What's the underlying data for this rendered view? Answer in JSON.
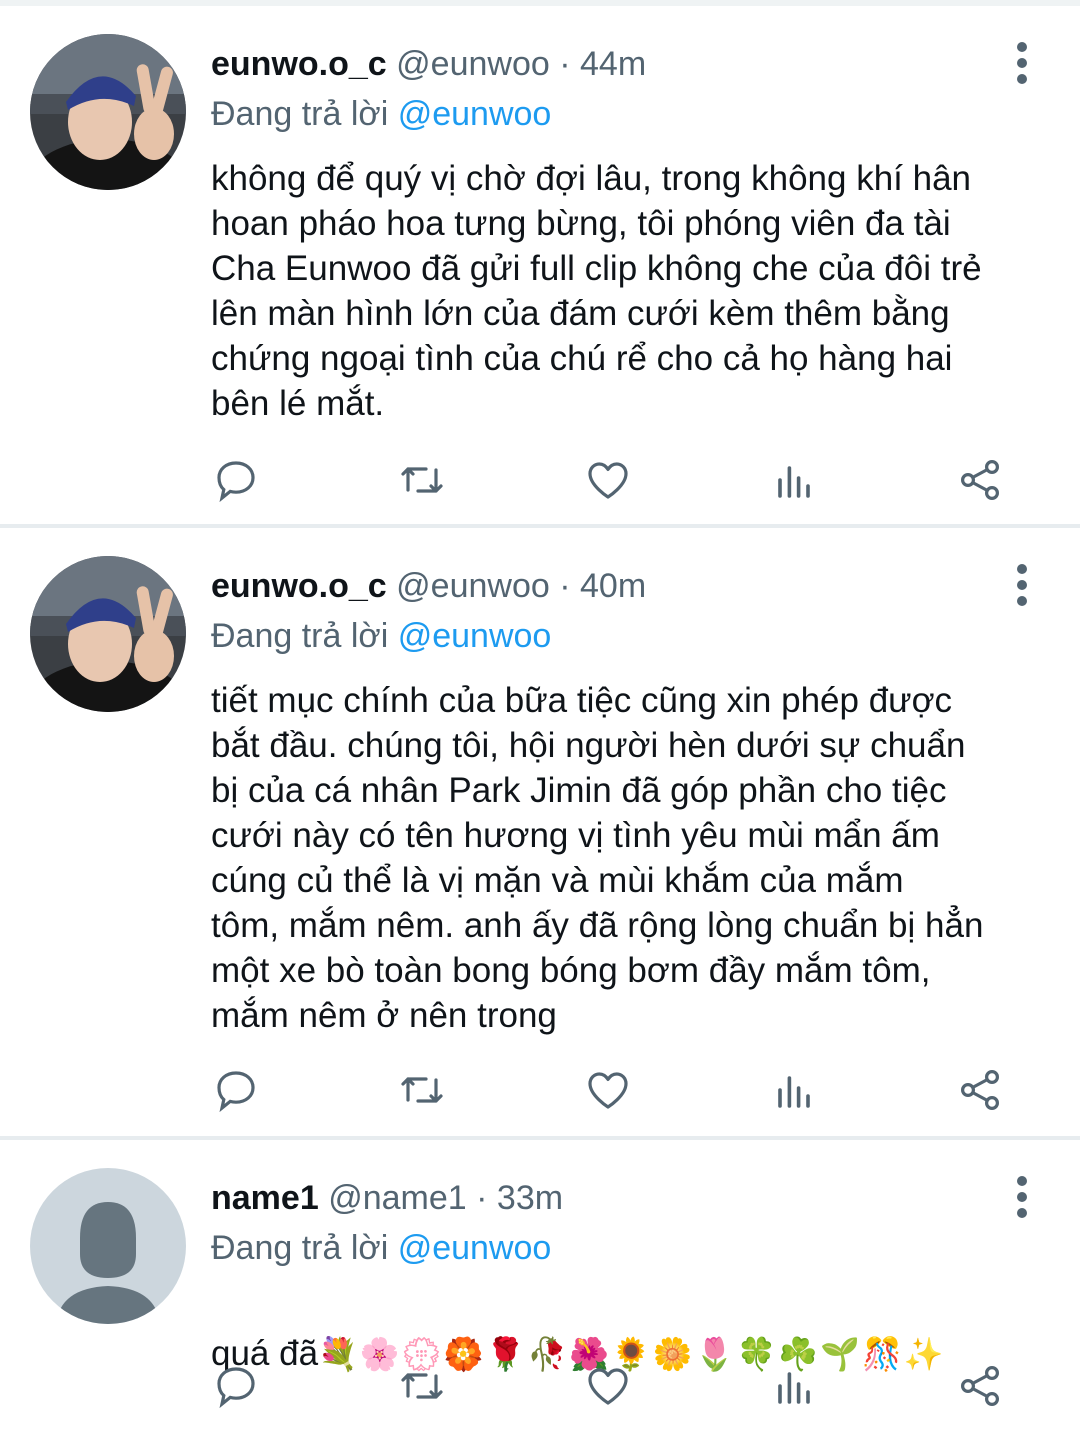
{
  "tweets": [
    {
      "name": "eunwo.o_c",
      "handle": "@eunwoo",
      "dot": "·",
      "time": "44m",
      "reply_prefix": "Đang trả lời",
      "reply_to": "@eunwoo",
      "text": "không để quý vị chờ đợi lâu, trong không khí hân\nhoan pháo hoa tưng bừng, tôi phóng viên đa tài\nCha Eunwoo đã gửi full clip không che của đôi trẻ\nlên màn hình lớn của đám cưới kèm thêm bằng\nchứng ngoại tình của chú rể cho cả họ hàng hai\nbên lé mắt.",
      "avatar": "photo"
    },
    {
      "name": "eunwo.o_c",
      "handle": "@eunwoo",
      "dot": "·",
      "time": "40m",
      "reply_prefix": "Đang trả lời",
      "reply_to": "@eunwoo",
      "text": "tiết mục chính của bữa tiệc cũng xin phép được\nbắt đầu. chúng tôi, hội người hèn dưới sự chuẩn\nbị của cá nhân Park Jimin đã góp phần cho tiệc\ncưới này có tên hương vị tình yêu mùi mẩn ấm\ncúng củ thể là vị mặn và mùi khắm của mắm\ntôm, mắm nêm. anh ấy đã rộng lòng chuẩn bị hẳn\nmột xe bò toàn bong bóng bơm đầy mắm tôm,\nmắm nêm ở nên trong",
      "avatar": "photo"
    },
    {
      "name": "name1",
      "handle": "@name1",
      "dot": "·",
      "time": "33m",
      "reply_prefix": "Đang trả lời",
      "reply_to": "@eunwoo",
      "text": "quá đã",
      "emojis": "💐🌸💮🏵️🌹🥀🌺🌻🌼🌷🍀☘️🌱🎊✨",
      "avatar": "default"
    }
  ],
  "action_icons": [
    "reply-icon",
    "retweet-icon",
    "like-icon",
    "analytics-icon",
    "share-icon"
  ],
  "colors": {
    "text": "#0f1419",
    "secondary": "#536471",
    "link": "#1d9bf0",
    "divider": "#e7ecef"
  }
}
